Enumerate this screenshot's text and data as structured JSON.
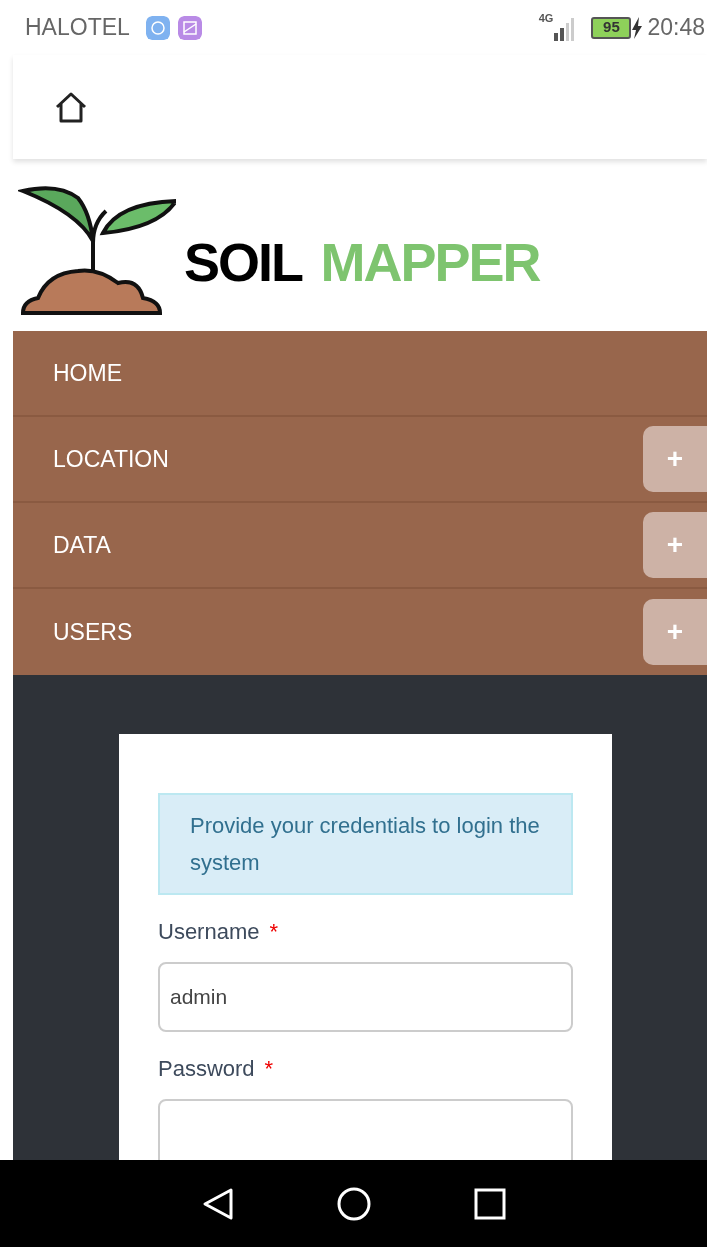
{
  "status_bar": {
    "carrier": "HALOTEL",
    "network": "4G",
    "battery": "95",
    "charging": true,
    "time": "20:48"
  },
  "logo": {
    "word_1": "SOIL",
    "word_2": "MAPPER"
  },
  "menu": [
    {
      "label": "HOME"
    },
    {
      "label": "LOCATION",
      "toggle": "+"
    },
    {
      "label": "DATA",
      "toggle": "+"
    },
    {
      "label": "USERS",
      "toggle": "+"
    }
  ],
  "login": {
    "message": "Provide your credentials to login the system",
    "fields": [
      {
        "label": "Username",
        "required": "*",
        "value": "admin"
      },
      {
        "label": "Password",
        "required": "*"
      }
    ]
  }
}
